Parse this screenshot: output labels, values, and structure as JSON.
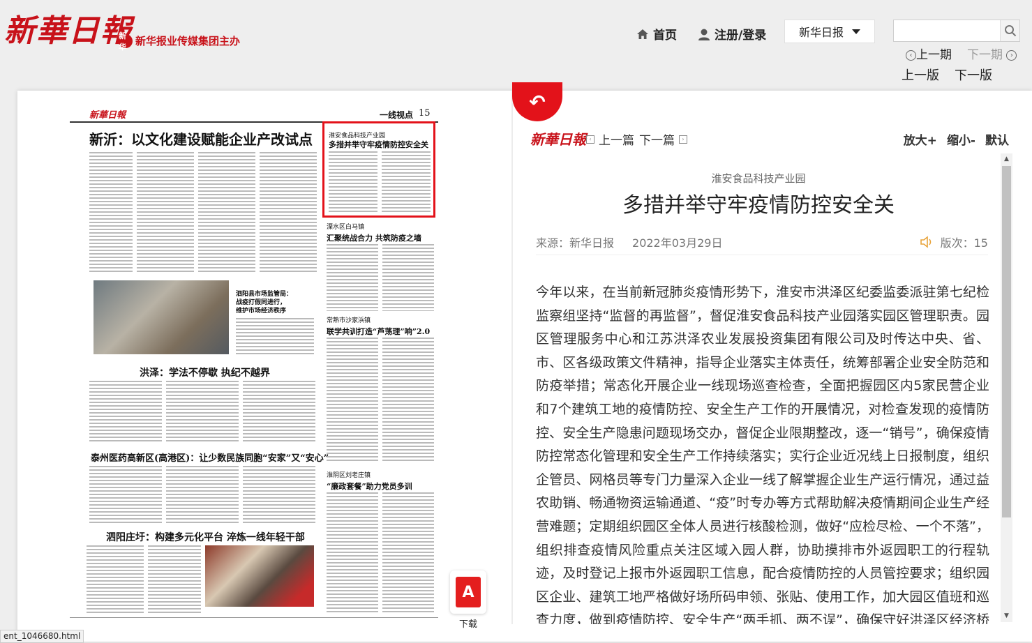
{
  "header": {
    "logo": "新華日報",
    "sponsor": "新华报业传媒集团主办",
    "sponsor_mark": "新华",
    "nav": {
      "home": "首页",
      "login": "注册/登录"
    },
    "paper_select": "新华日报",
    "search_placeholder": "",
    "period_prev": "上一期",
    "period_next": "下一期",
    "edition_prev": "上一版",
    "edition_next": "下一版"
  },
  "newspaper_page": {
    "logo": "新華日報",
    "section": "一线视点",
    "page_no": "15",
    "headlines": [
      "新沂：以文化建设赋能企业产改试点",
      "洪泽：学法不停歇  执纪不越界",
      "泰州医药高新区(高港区)：让少数民族同胞“安家”又“安心”",
      "泗阳庄圩：构建多元化平台  淬炼一线年轻干部"
    ],
    "highlight": {
      "sub": "淮安食品科技产业园",
      "title": "多措并举守牢疫情防控安全关"
    },
    "side_titles": [
      {
        "sub": "溧水区白马镇",
        "title": "汇聚统战合力  共筑防疫之墙"
      },
      {
        "sub": "常熟市沙家浜镇",
        "title": "联学共训打造“芦荡理”响”2.0"
      },
      {
        "sub": "淮阴区刘老庄镇",
        "title": "“廉政套餐”助力党员多训"
      }
    ],
    "photo_caption": [
      "泗阳县市场监管局：",
      "战疫打假同进行，",
      "维护市场经济秩序"
    ]
  },
  "download_label": "下载",
  "article": {
    "toolbar": {
      "logo": "新華日報",
      "prev": "上一篇",
      "next": "下一篇",
      "zoom_in": "放大+",
      "zoom_out": "缩小-",
      "reset": "默认"
    },
    "subtitle": "淮安食品科技产业园",
    "title": "多措并举守牢疫情防控安全关",
    "source": "来源：新华日报",
    "date": "2022年03月29日",
    "edition": "版次：15",
    "body": "今年以来，在当前新冠肺炎疫情形势下，淮安市洪泽区纪委监委派驻第七纪检监察组坚持“监督的再监督”，督促淮安食品科技产业园落实园区管理职责。园区管理服务中心和江苏洪泽农业发展投资集团有限公司及时传达中央、省、市、区各级政策文件精神，指导企业落实主体责任，统筹部署企业安全防范和防疫举措；常态化开展企业一线现场巡查检查，全面把握园区内5家民营企业和7个建筑工地的疫情防控、安全生产工作的开展情况，对检查发现的疫情防控、安全生产隐患问题现场交办，督促企业限期整改，逐一“销号”，确保疫情防控常态化管理和安全生产工作持续落实；实行企业近况线上日报制度，组织企管员、网格员等专门力量深入企业一线了解掌握企业生产运行情况，通过益农助销、畅通物资运输通道、“疫”时专办等方式帮助解决疫情期间企业生产经营难题；定期组织园区全体人员进行核酸检测，做好“应检尽检、一个不落”，组织排查疫情风险重点关注区域入园人群，协助摸排市外返园职工的行程轨迹，及时登记上报市外返园职工信息，配合疫情防控的人员管控要求；组织园区企业、建筑工地严格做好场所码申领、张贴、使用工作，加大园区值班和巡查力度，做到疫情防控、安全生产“两手抓、两不误”，确保守好洪泽区经济桥头堡南大门"
  },
  "status_bar": "ent_1046680.html"
}
